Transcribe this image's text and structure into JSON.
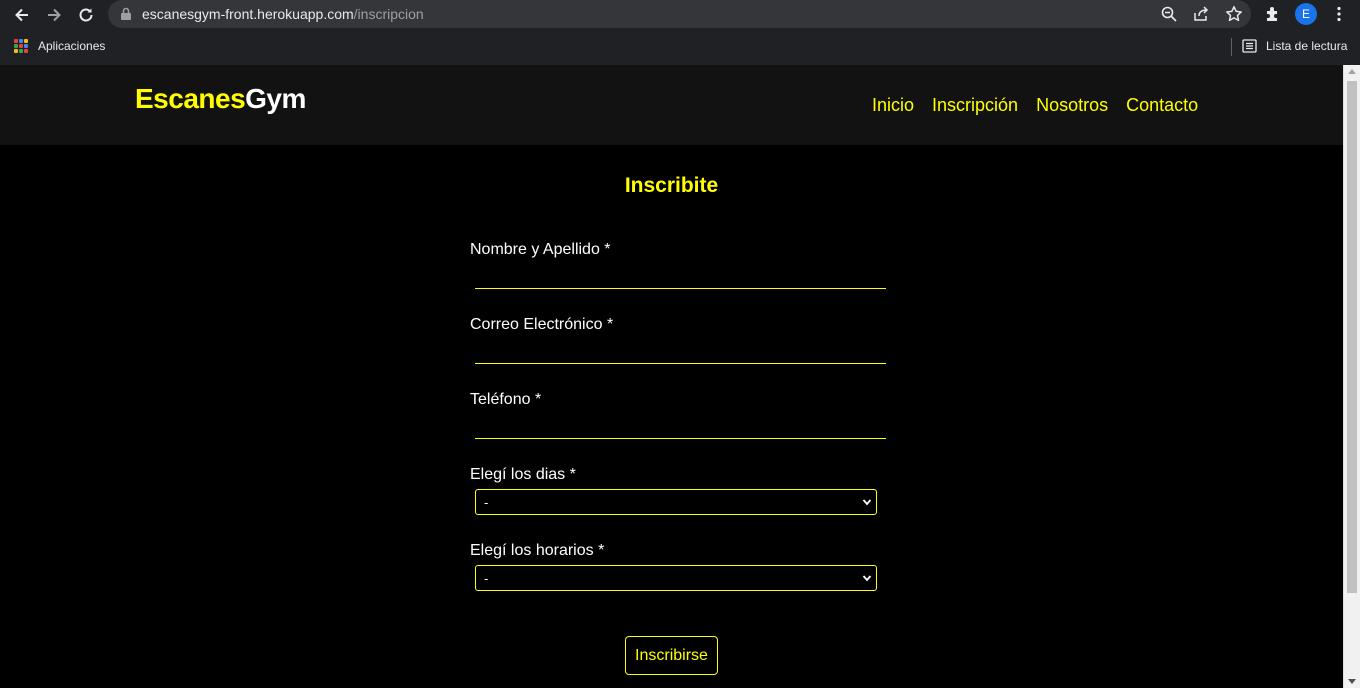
{
  "browser": {
    "url_domain": "escanesgym-front.herokuapp.com",
    "url_path": "/inscripcion",
    "avatar_letter": "E",
    "bookmarks": {
      "apps_label": "Aplicaciones",
      "reading_list_label": "Lista de lectura"
    }
  },
  "site": {
    "logo_part1": "Escanes",
    "logo_part2": "Gym",
    "nav": [
      "Inicio",
      "Inscripción",
      "Nosotros",
      "Contacto"
    ],
    "colors": {
      "accent": "#ffff00",
      "header_bg": "#121212",
      "page_bg": "#000000"
    }
  },
  "form": {
    "title": "Inscribite",
    "fields": {
      "name_label": "Nombre y Apellido *",
      "email_label": "Correo Electrónico *",
      "phone_label": "Teléfono *",
      "days_label": "Elegí los dias *",
      "days_value": "-",
      "hours_label": "Elegí los horarios *",
      "hours_value": "-"
    },
    "submit_label": "Inscribirse"
  }
}
